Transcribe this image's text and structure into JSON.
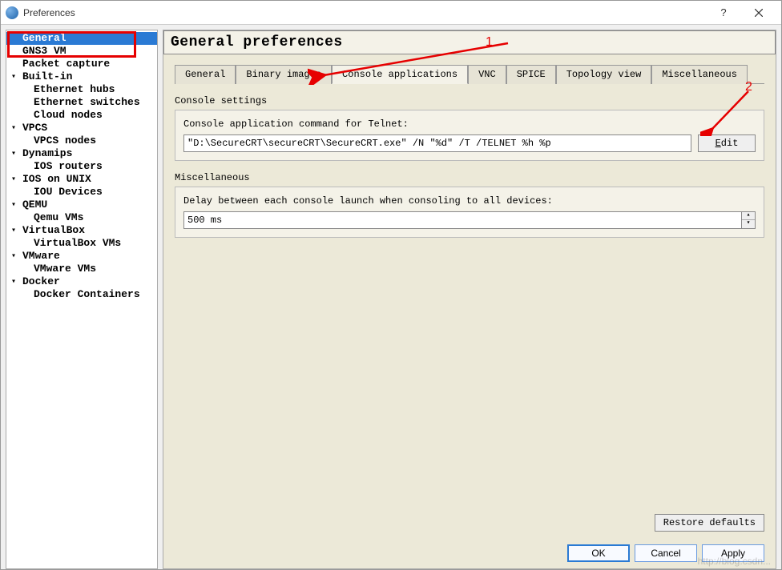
{
  "window": {
    "title": "Preferences"
  },
  "sidebar": {
    "items": [
      {
        "label": "General",
        "selected": true
      },
      {
        "label": "GNS3 VM"
      },
      {
        "label": "Packet capture"
      },
      {
        "label": "Built-in",
        "expandable": true
      },
      {
        "label": "Ethernet hubs",
        "child": true
      },
      {
        "label": "Ethernet switches",
        "child": true
      },
      {
        "label": "Cloud nodes",
        "child": true
      },
      {
        "label": "VPCS",
        "expandable": true
      },
      {
        "label": "VPCS nodes",
        "child": true
      },
      {
        "label": "Dynamips",
        "expandable": true
      },
      {
        "label": "IOS routers",
        "child": true
      },
      {
        "label": "IOS on UNIX",
        "expandable": true
      },
      {
        "label": "IOU Devices",
        "child": true
      },
      {
        "label": "QEMU",
        "expandable": true
      },
      {
        "label": "Qemu VMs",
        "child": true
      },
      {
        "label": "VirtualBox",
        "expandable": true
      },
      {
        "label": "VirtualBox VMs",
        "child": true
      },
      {
        "label": "VMware",
        "expandable": true
      },
      {
        "label": "VMware VMs",
        "child": true
      },
      {
        "label": "Docker",
        "expandable": true
      },
      {
        "label": "Docker Containers",
        "child": true
      }
    ]
  },
  "page": {
    "title": "General preferences"
  },
  "tabs": [
    {
      "label": "General"
    },
    {
      "label": "Binary images"
    },
    {
      "label": "Console applications",
      "active": true
    },
    {
      "label": "VNC"
    },
    {
      "label": "SPICE"
    },
    {
      "label": "Topology view"
    },
    {
      "label": "Miscellaneous"
    }
  ],
  "console": {
    "section_label": "Console settings",
    "command_label": "Console application command for Telnet:",
    "command_value": "\"D:\\SecureCRT\\secureCRT\\SecureCRT.exe\" /N \"%d\" /T /TELNET %h %p",
    "edit_label": "Edit"
  },
  "misc": {
    "section_label": "Miscellaneous",
    "delay_label": "Delay between each console launch when consoling to all devices:",
    "delay_value": "500 ms"
  },
  "restore_label": "Restore defaults",
  "buttons": {
    "ok": "OK",
    "cancel": "Cancel",
    "apply": "Apply"
  },
  "annotations": {
    "one": "1",
    "two": "2"
  }
}
